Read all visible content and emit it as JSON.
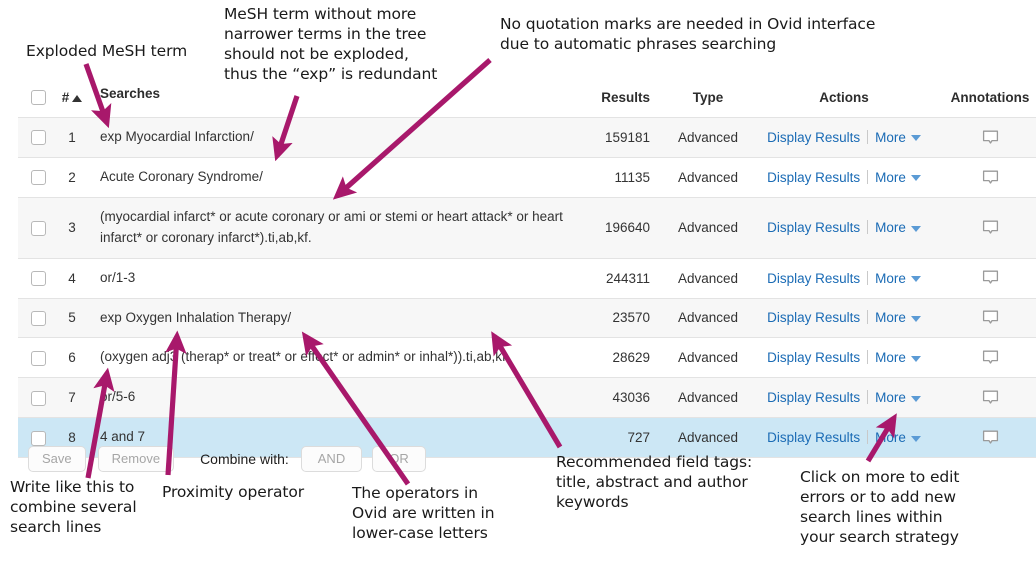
{
  "table": {
    "headers": {
      "checkbox": "",
      "number": "#",
      "searches": "Searches",
      "results": "Results",
      "type": "Type",
      "actions": "Actions",
      "annotations": "Annotations"
    },
    "rows": [
      {
        "num": "1",
        "search": "exp Myocardial Infarction/",
        "results": "159181",
        "type": "Advanced",
        "display": "Display Results",
        "more": "More"
      },
      {
        "num": "2",
        "search": "Acute Coronary Syndrome/",
        "results": "11135",
        "type": "Advanced",
        "display": "Display Results",
        "more": "More"
      },
      {
        "num": "3",
        "search": "(myocardial infarct* or acute coronary or ami or stemi or heart attack* or heart infarct* or coronary infarct*).ti,ab,kf.",
        "results": "196640",
        "type": "Advanced",
        "display": "Display Results",
        "more": "More"
      },
      {
        "num": "4",
        "search": "or/1-3",
        "results": "244311",
        "type": "Advanced",
        "display": "Display Results",
        "more": "More"
      },
      {
        "num": "5",
        "search": "exp Oxygen Inhalation Therapy/",
        "results": "23570",
        "type": "Advanced",
        "display": "Display Results",
        "more": "More"
      },
      {
        "num": "6",
        "search": "(oxygen adj3 (therap* or treat* or effect* or admin* or inhal*)).ti,ab,kf.",
        "results": "28629",
        "type": "Advanced",
        "display": "Display Results",
        "more": "More"
      },
      {
        "num": "7",
        "search": "or/5-6",
        "results": "43036",
        "type": "Advanced",
        "display": "Display Results",
        "more": "More"
      },
      {
        "num": "8",
        "search": "4 and 7",
        "results": "727",
        "type": "Advanced",
        "display": "Display Results",
        "more": "More"
      }
    ]
  },
  "toolbar": {
    "save": "Save",
    "remove": "Remove",
    "combine_label": "Combine with:",
    "and": "AND",
    "or": "OR"
  },
  "annotations": {
    "exploded_mesh": "Exploded MeSH term",
    "mesh_no_narrower": "MeSH term without more\nnarrower terms in the tree\nshould not be exploded,\nthus the “exp” is redundant",
    "no_quotation": "No quotation marks are needed in Ovid interface\ndue to automatic phrases searching",
    "write_like_this": "Write like this to\ncombine several\nsearch lines",
    "proximity": "Proximity operator",
    "lower_case": "The operators in\nOvid are written in\nlower-case letters",
    "field_tags": "Recommended field tags:\ntitle, abstract and author\nkeywords",
    "click_more": "Click on more to edit\nerrors or to add new\nsearch lines within\nyour search strategy"
  },
  "colors": {
    "arrow": "#a8186b",
    "link": "#1a6bb5",
    "selected_row": "#cce7f5",
    "alt_row": "#f7f7f7"
  }
}
